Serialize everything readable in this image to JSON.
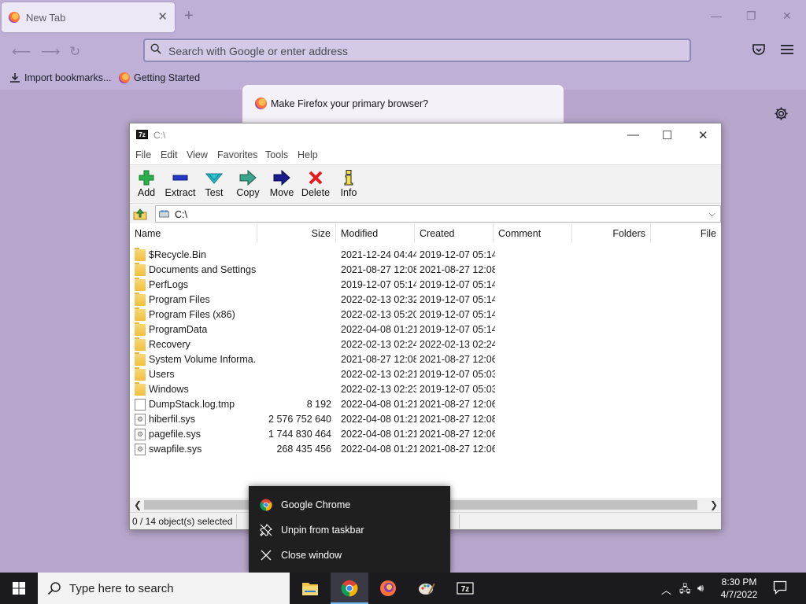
{
  "firefox": {
    "tab_title": "New Tab",
    "url_placeholder": "Search with Google or enter address",
    "bookmarks": [
      {
        "label": "Import bookmarks..."
      },
      {
        "label": "Getting Started"
      }
    ],
    "banner_text": "Make Firefox your primary browser?"
  },
  "sevenzip": {
    "title": "C:\\",
    "menus": [
      "File",
      "Edit",
      "View",
      "Favorites",
      "Tools",
      "Help"
    ],
    "toolbar": [
      "Add",
      "Extract",
      "Test",
      "Copy",
      "Move",
      "Delete",
      "Info"
    ],
    "address": "C:\\",
    "columns": [
      "Name",
      "Size",
      "Modified",
      "Created",
      "Comment",
      "Folders",
      "File"
    ],
    "rows": [
      {
        "name": "$Recycle.Bin",
        "size": "",
        "modified": "2021-12-24 04:44",
        "created": "2019-12-07 05:14",
        "kind": "folder"
      },
      {
        "name": "Documents and Settings",
        "size": "",
        "modified": "2021-08-27 12:08",
        "created": "2021-08-27 12:08",
        "kind": "folder"
      },
      {
        "name": "PerfLogs",
        "size": "",
        "modified": "2019-12-07 05:14",
        "created": "2019-12-07 05:14",
        "kind": "folder"
      },
      {
        "name": "Program Files",
        "size": "",
        "modified": "2022-02-13 02:32",
        "created": "2019-12-07 05:14",
        "kind": "folder"
      },
      {
        "name": "Program Files (x86)",
        "size": "",
        "modified": "2022-02-13 05:20",
        "created": "2019-12-07 05:14",
        "kind": "folder"
      },
      {
        "name": "ProgramData",
        "size": "",
        "modified": "2022-04-08 01:21",
        "created": "2019-12-07 05:14",
        "kind": "folder"
      },
      {
        "name": "Recovery",
        "size": "",
        "modified": "2022-02-13 02:24",
        "created": "2022-02-13 02:24",
        "kind": "folder"
      },
      {
        "name": "System Volume Informa...",
        "size": "",
        "modified": "2021-08-27 12:08",
        "created": "2021-08-27 12:06",
        "kind": "folder"
      },
      {
        "name": "Users",
        "size": "",
        "modified": "2022-02-13 02:21",
        "created": "2019-12-07 05:03",
        "kind": "folder"
      },
      {
        "name": "Windows",
        "size": "",
        "modified": "2022-02-13 02:23",
        "created": "2019-12-07 05:03",
        "kind": "folder"
      },
      {
        "name": "DumpStack.log.tmp",
        "size": "8 192",
        "modified": "2022-04-08 01:21",
        "created": "2021-08-27 12:06",
        "kind": "file"
      },
      {
        "name": "hiberfil.sys",
        "size": "2 576 752 640",
        "modified": "2022-04-08 01:21",
        "created": "2021-08-27 12:08",
        "kind": "sys"
      },
      {
        "name": "pagefile.sys",
        "size": "1 744 830 464",
        "modified": "2022-04-08 01:21",
        "created": "2021-08-27 12:06",
        "kind": "sys"
      },
      {
        "name": "swapfile.sys",
        "size": "268 435 456",
        "modified": "2022-04-08 01:21",
        "created": "2021-08-27 12:06",
        "kind": "sys"
      }
    ],
    "status": "0 / 14 object(s) selected"
  },
  "jumplist": {
    "items": [
      {
        "label": "Google Chrome",
        "icon": "chrome-icon"
      },
      {
        "label": "Unpin from taskbar",
        "icon": "unpin-icon"
      },
      {
        "label": "Close window",
        "icon": "close-icon"
      }
    ]
  },
  "taskbar": {
    "search_placeholder": "Type here to search",
    "time": "8:30 PM",
    "date": "4/7/2022"
  },
  "colors": {
    "firefox_chrome": "#bfb0d8",
    "taskbar": "#1a1a1f",
    "jumplist": "#1f1f1f"
  }
}
